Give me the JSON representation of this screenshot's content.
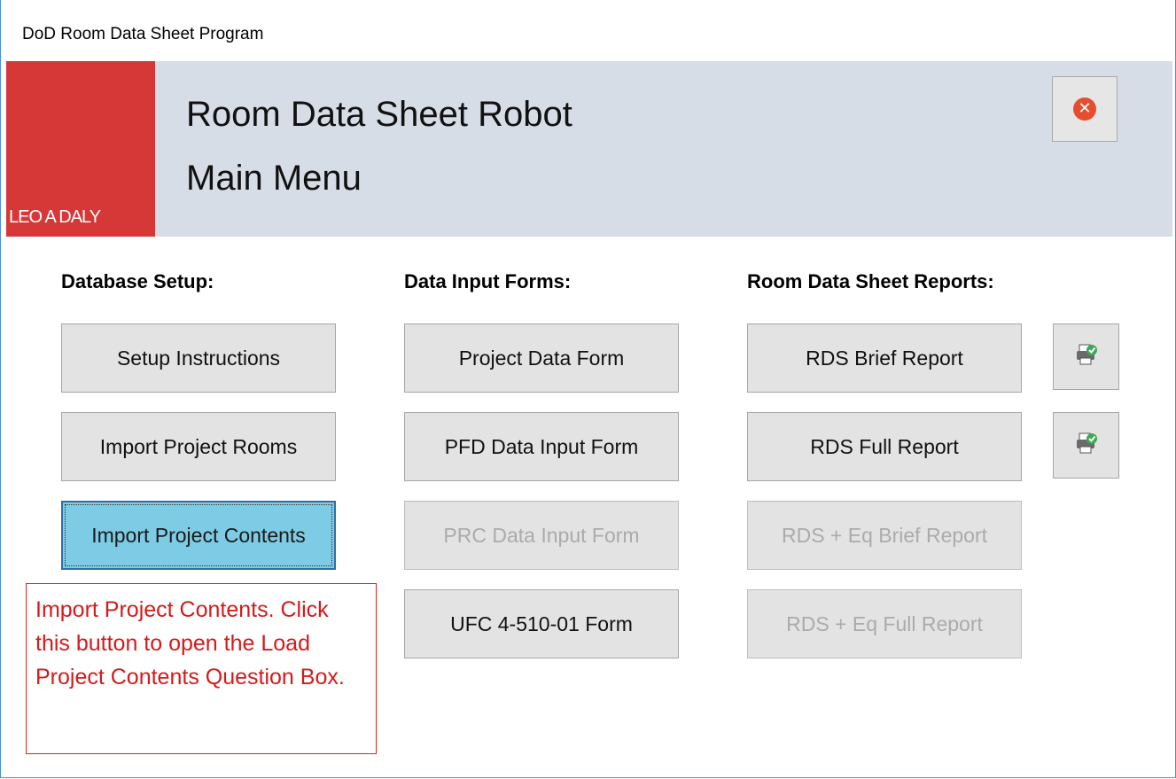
{
  "window": {
    "title": "DoD Room Data Sheet Program"
  },
  "header": {
    "logo_text": "LEO A DALY",
    "heading_line1": "Room Data Sheet Robot",
    "heading_line2": "Main Menu",
    "close_icon": "close-circle-icon"
  },
  "sections": {
    "database_setup": {
      "label": "Database Setup:",
      "buttons": [
        "Setup Instructions",
        "Import Project Rooms",
        "Import Project Contents"
      ]
    },
    "data_input": {
      "label": "Data Input Forms:",
      "buttons": [
        "Project Data Form",
        "PFD Data Input Form",
        "PRC Data Input Form",
        "UFC 4-510-01 Form"
      ]
    },
    "reports": {
      "label": "Room Data Sheet Reports:",
      "buttons": [
        "RDS Brief Report",
        "RDS Full Report",
        "RDS + Eq Brief Report",
        "RDS + Eq Full Report"
      ],
      "print_icon": "print-preview-icon"
    }
  },
  "states": {
    "active_button": "Import Project Contents",
    "disabled_buttons": [
      "PRC Data Input Form",
      "RDS + Eq Brief Report",
      "RDS + Eq Full Report"
    ]
  },
  "callout": {
    "text": "Import Project Contents. Click this button to open the Load Project Contents Question Box."
  },
  "colors": {
    "logo_red": "#d63838",
    "header_bg": "#d7dde7",
    "active_button": "#7dcbe4",
    "callout_red": "#d51a1a"
  }
}
